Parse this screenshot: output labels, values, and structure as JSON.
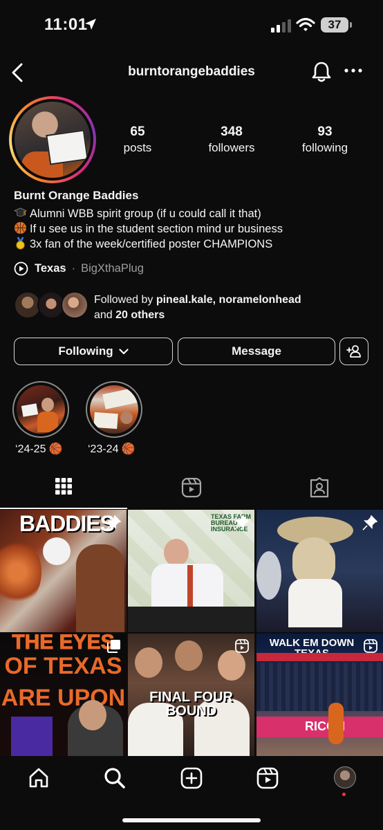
{
  "status_bar": {
    "time": "11:01",
    "battery": "37"
  },
  "header": {
    "username": "burntorangebaddies"
  },
  "stats": [
    {
      "num": "65",
      "label": "posts"
    },
    {
      "num": "348",
      "label": "followers"
    },
    {
      "num": "93",
      "label": "following"
    }
  ],
  "bio": {
    "name": "Burnt Orange Baddies",
    "lines": [
      "Alumni WBB spirit group (if u could call it that)",
      "If u see us in the student section mind ur business",
      "3x fan of the week/certified poster CHAMPIONS"
    ]
  },
  "link": {
    "label": "Texas",
    "separator": "·",
    "sub": "BigXthaPlug"
  },
  "followed_by": {
    "prefix": "Followed by ",
    "names": "pineal.kale, noramelonhead",
    "and": "and ",
    "others": "20 others"
  },
  "buttons": {
    "following": "Following",
    "message": "Message"
  },
  "highlights": [
    {
      "label": "‘24-25 🏀"
    },
    {
      "label": "‘23-24 🏀"
    }
  ],
  "grid": {
    "tile1_text": "BADDIES",
    "tile2_text": "TEXAS FARM BUREAU INSURANCE",
    "tile4_line1": "THE EYES",
    "tile4_line2": "OF TEXAS",
    "tile4_line3": "ARE UPON",
    "tile5_text": "FINAL FOUR BOUND",
    "tile6_text": "WALK EM DOWN TEXAS",
    "tile6_banner": "RICOH"
  },
  "icons": {
    "back": "chevron-left-icon",
    "bell": "bell-icon",
    "more": "more-horizontal-icon",
    "add_user": "add-user-icon",
    "grid_tab": "grid-icon",
    "reels_tab": "reels-icon",
    "tagged_tab": "tagged-icon",
    "home": "home-icon",
    "search": "search-icon",
    "create": "create-icon",
    "reels": "reels-icon",
    "profile": "profile-avatar"
  },
  "colors": {
    "background": "#0c0c0d",
    "notification_dot": "#ff3040",
    "texas_orange": "#bf5700"
  }
}
